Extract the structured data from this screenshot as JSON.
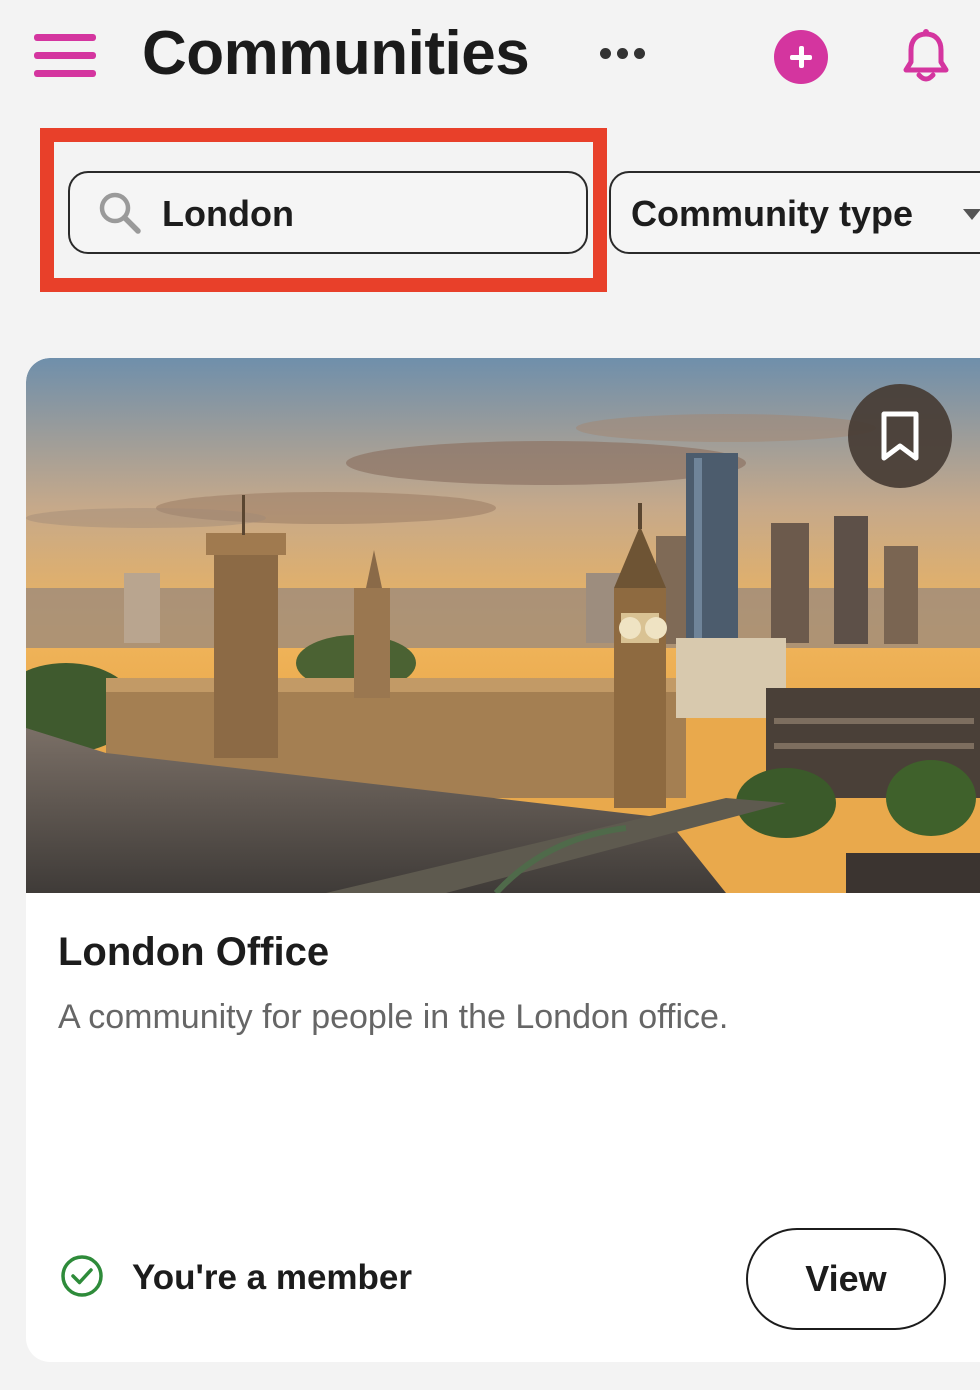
{
  "theme": {
    "accent": "#d4359f",
    "highlight": "#e8402a",
    "member_green": "#2e8b3a"
  },
  "header": {
    "title": "Communities",
    "menu_icon": "hamburger-menu-icon",
    "more_icon": "more-horizontal-icon",
    "add_icon": "plus-circle-icon",
    "notifications_icon": "bell-icon"
  },
  "filters": {
    "search": {
      "value": "London",
      "icon": "search-icon"
    },
    "community_type": {
      "label": "Community type",
      "icon": "chevron-down-icon"
    }
  },
  "card": {
    "image_alt": "Westminster skyline at sunset",
    "bookmark_icon": "bookmark-icon",
    "title": "London Office",
    "description": "A community for people in the London office.",
    "membership": {
      "text": "You're a member",
      "icon": "check-circle-icon"
    },
    "action_label": "View"
  }
}
